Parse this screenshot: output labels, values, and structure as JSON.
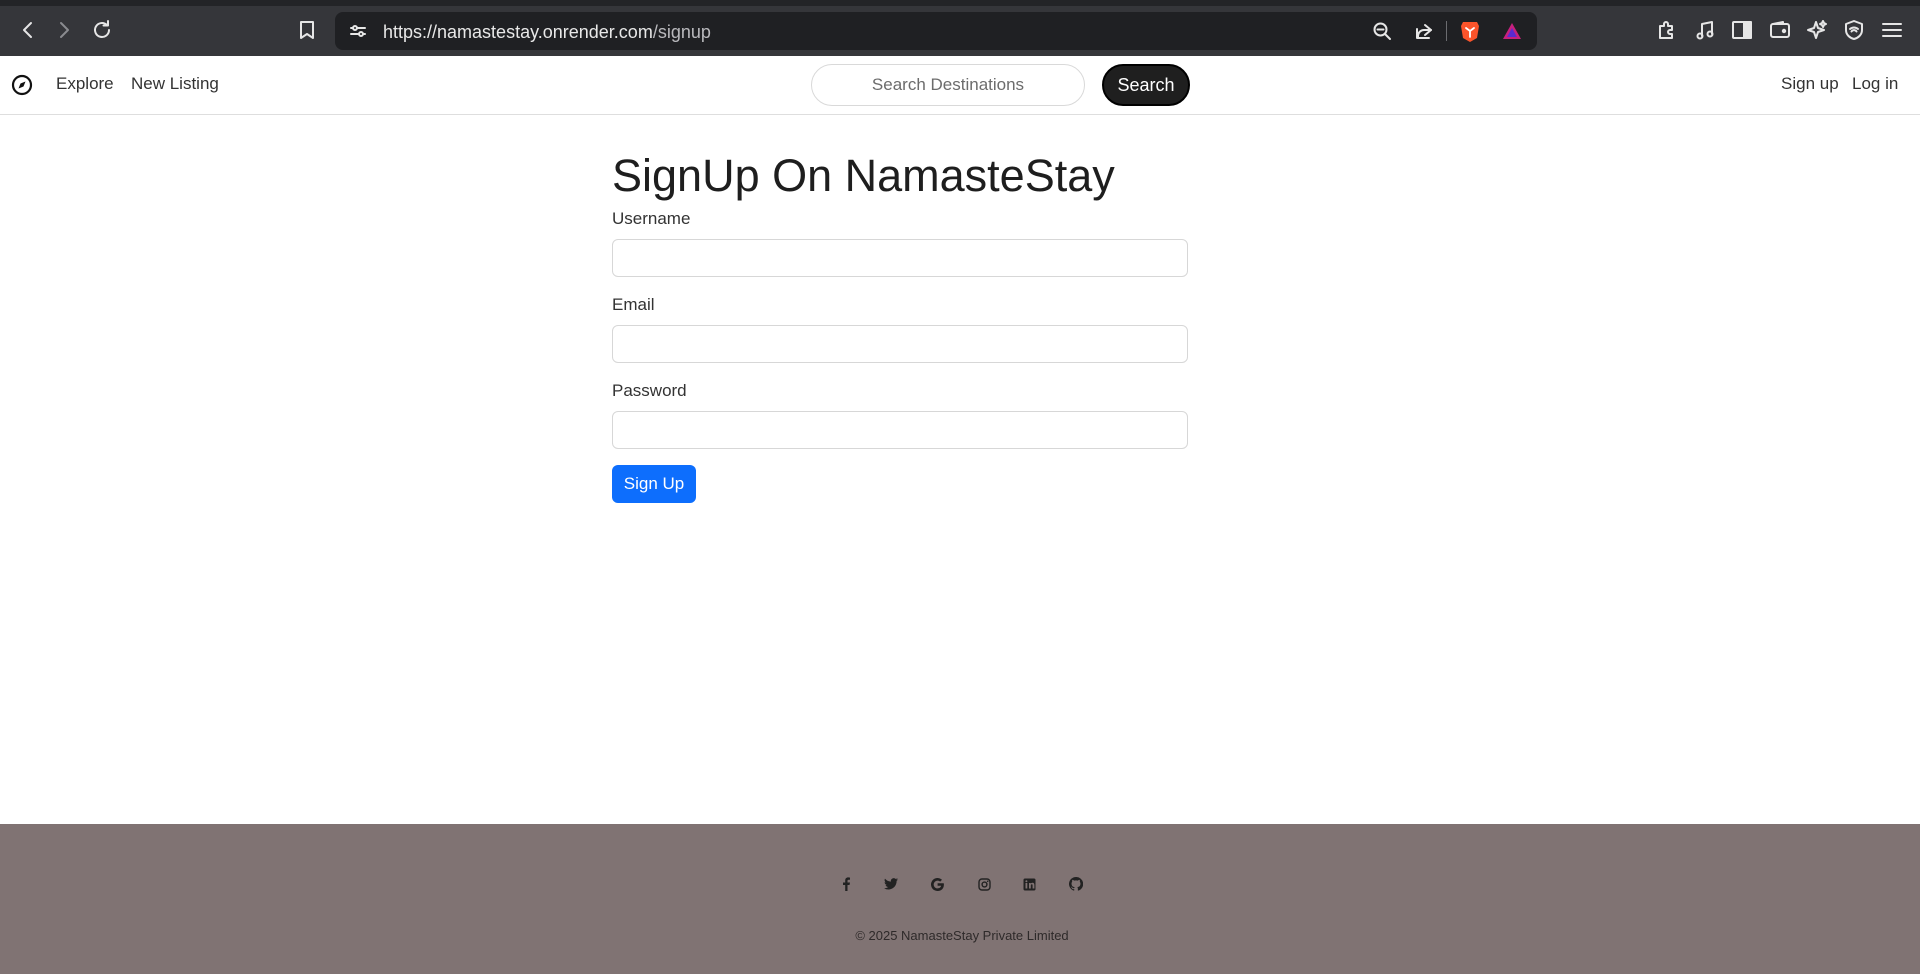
{
  "browser": {
    "url_host": "https://namastestay.onrender.com",
    "url_path": "/signup",
    "icons": [
      "back-icon",
      "forward-icon",
      "reload-icon",
      "bookmark-icon",
      "site-settings-icon",
      "zoom-out-icon",
      "share-icon",
      "brave-shields-icon",
      "rewards-icon",
      "extensions-icon",
      "media-icon",
      "sidebar-icon",
      "wallet-icon",
      "leo-ai-icon",
      "vpn-icon",
      "menu-icon"
    ]
  },
  "navbar": {
    "logo_icon": "compass-icon",
    "explore": "Explore",
    "new_listing": "New Listing",
    "search_placeholder": "Search Destinations",
    "search_button": "Search",
    "signup": "Sign up",
    "login": "Log in"
  },
  "form": {
    "title": "SignUp On NamasteStay",
    "username_label": "Username",
    "email_label": "Email",
    "password_label": "Password",
    "username_value": "",
    "email_value": "",
    "password_value": "",
    "submit": "Sign Up"
  },
  "footer": {
    "social": [
      "facebook-icon",
      "twitter-icon",
      "google-icon",
      "instagram-icon",
      "linkedin-icon",
      "github-icon"
    ],
    "copyright": "© 2025 NamasteStay Private Limited"
  },
  "colors": {
    "primary": "#0d6efd",
    "footer_bg": "#807373",
    "search_button_bg": "#1f1f1f"
  }
}
